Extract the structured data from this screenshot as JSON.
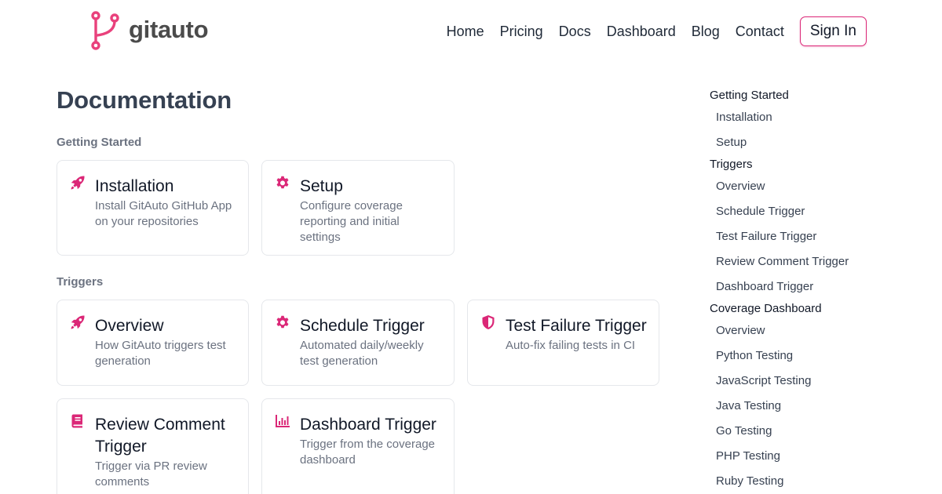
{
  "brand": {
    "name": "gitauto",
    "accent": "#e9417c"
  },
  "nav": {
    "links": [
      "Home",
      "Pricing",
      "Docs",
      "Dashboard",
      "Blog",
      "Contact"
    ],
    "signin": "Sign In"
  },
  "main": {
    "title": "Documentation",
    "sections": [
      {
        "title": "Getting Started",
        "cards": [
          {
            "icon": "rocket-icon",
            "title": "Installation",
            "desc": "Install GitAuto GitHub App on your repositories"
          },
          {
            "icon": "gear-icon",
            "title": "Setup",
            "desc": "Configure coverage reporting and initial settings"
          }
        ]
      },
      {
        "title": "Triggers",
        "cards": [
          {
            "icon": "rocket-icon",
            "title": "Overview",
            "desc": "How GitAuto triggers test generation"
          },
          {
            "icon": "gear-icon",
            "title": "Schedule Trigger",
            "desc": "Automated daily/weekly test generation"
          },
          {
            "icon": "shield-icon",
            "title": "Test Failure Trigger",
            "desc": "Auto-fix failing tests in CI"
          },
          {
            "icon": "book-icon",
            "title": "Review Comment Trigger",
            "desc": "Trigger via PR review comments"
          },
          {
            "icon": "chart-icon",
            "title": "Dashboard Trigger",
            "desc": "Trigger from the coverage dashboard"
          }
        ]
      }
    ]
  },
  "toc": {
    "groups": [
      {
        "title": "Getting Started",
        "items": [
          "Installation",
          "Setup"
        ]
      },
      {
        "title": "Triggers",
        "items": [
          "Overview",
          "Schedule Trigger",
          "Test Failure Trigger",
          "Review Comment Trigger",
          "Dashboard Trigger"
        ]
      },
      {
        "title": "Coverage Dashboard",
        "items": [
          "Overview",
          "Python Testing",
          "JavaScript Testing",
          "Java Testing",
          "Go Testing",
          "PHP Testing",
          "Ruby Testing"
        ]
      }
    ]
  }
}
